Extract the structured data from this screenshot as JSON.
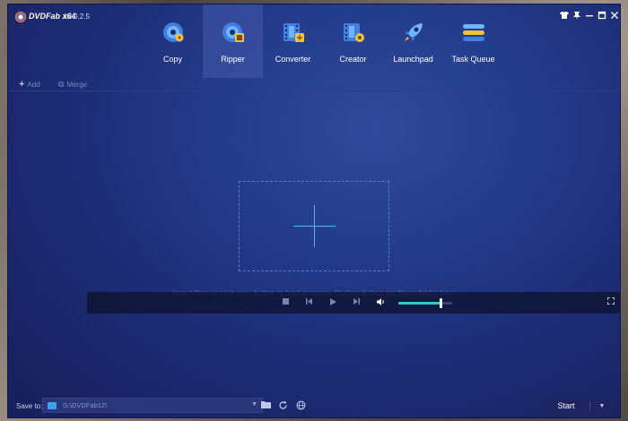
{
  "app": {
    "brand": "DVDFab x64",
    "version": "12.0.2.5"
  },
  "window_controls": {
    "icons": [
      "shirt-icon",
      "pin-icon",
      "minimize-icon",
      "maximize-icon",
      "close-icon"
    ]
  },
  "nav": {
    "tabs": [
      {
        "label": "Copy",
        "icon": "disc-copy-icon",
        "active": false
      },
      {
        "label": "Ripper",
        "icon": "disc-ripper-icon",
        "active": true
      },
      {
        "label": "Converter",
        "icon": "film-converter-icon",
        "active": false
      },
      {
        "label": "Creator",
        "icon": "film-creator-icon",
        "active": false
      },
      {
        "label": "Launchpad",
        "icon": "rocket-icon",
        "active": false
      },
      {
        "label": "Task Queue",
        "icon": "task-queue-icon",
        "active": false
      }
    ]
  },
  "toolbar": {
    "add_label": "Add",
    "merge_label": "Merge"
  },
  "main": {
    "hint": "Insert Disc or click on + button to load a source Or drag & drop iso file or folder here"
  },
  "player": {
    "volume_percent": 78
  },
  "bottom": {
    "save_to_label": "Save to:",
    "path": "G:\\DVDFab12\\",
    "start_label": "Start"
  },
  "colors": {
    "accent": "#4fb6ee",
    "volume": "#2ad0c8",
    "window_bg": "#243c8c"
  }
}
